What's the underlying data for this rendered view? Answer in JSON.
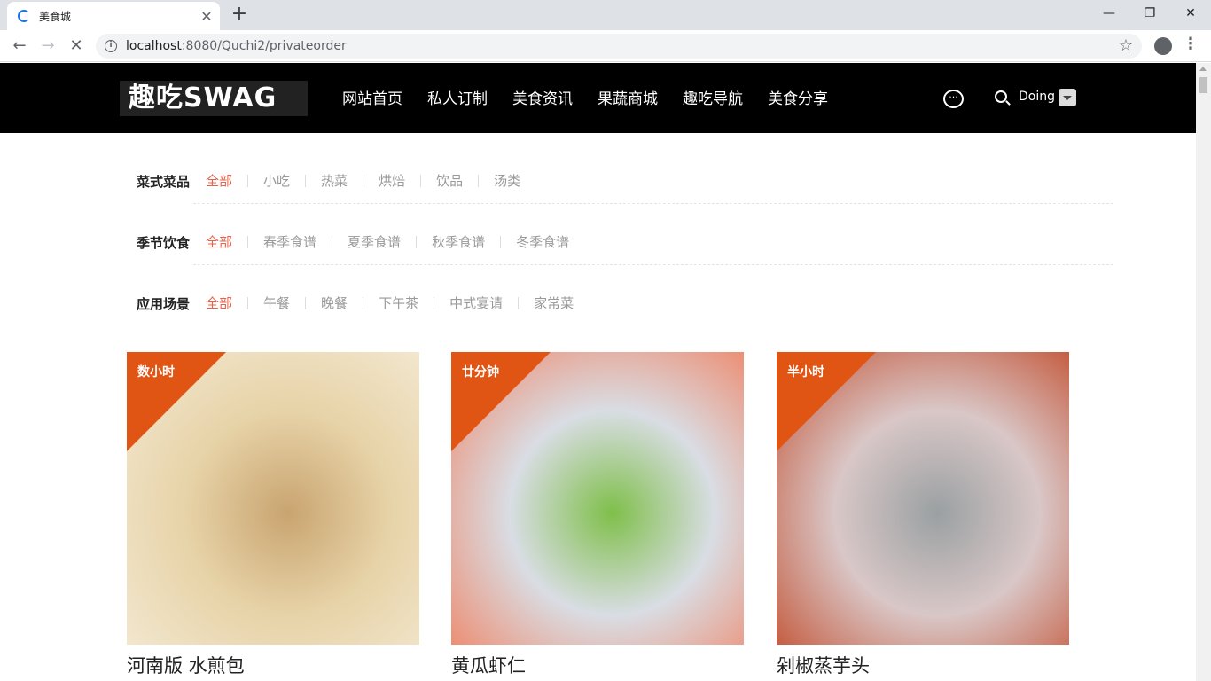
{
  "browser": {
    "tab_title": "美食城",
    "url_host": "localhost",
    "url_path": ":8080/Quchi2/privateorder"
  },
  "site": {
    "logo": "趣吃SWAG",
    "nav": [
      "网站首页",
      "私人订制",
      "美食资讯",
      "果蔬商城",
      "趣吃导航",
      "美食分享"
    ],
    "username": "Doing"
  },
  "filters": [
    {
      "label": "菜式菜品",
      "options": [
        "全部",
        "小吃",
        "热菜",
        "烘焙",
        "饮品",
        "汤类"
      ],
      "active": 0
    },
    {
      "label": "季节饮食",
      "options": [
        "全部",
        "春季食谱",
        "夏季食谱",
        "秋季食谱",
        "冬季食谱"
      ],
      "active": 0
    },
    {
      "label": "应用场景",
      "options": [
        "全部",
        "午餐",
        "晚餐",
        "下午茶",
        "中式宴请",
        "家常菜"
      ],
      "active": 0
    }
  ],
  "cards": [
    {
      "time": "数小时",
      "name": "河南版 水煎包",
      "colors": [
        "#e7d3a8",
        "#c9a470",
        "#f4ead5"
      ]
    },
    {
      "time": "廿分钟",
      "name": "黄瓜虾仁",
      "colors": [
        "#d9dde4",
        "#7fbf4a",
        "#f08060"
      ]
    },
    {
      "time": "半小时",
      "name": "剁椒蒸芋头",
      "colors": [
        "#d9c7c7",
        "#9aa0a2",
        "#c14a2a"
      ]
    }
  ],
  "colors": {
    "accent": "#e8614a",
    "tag": "#e05414"
  }
}
